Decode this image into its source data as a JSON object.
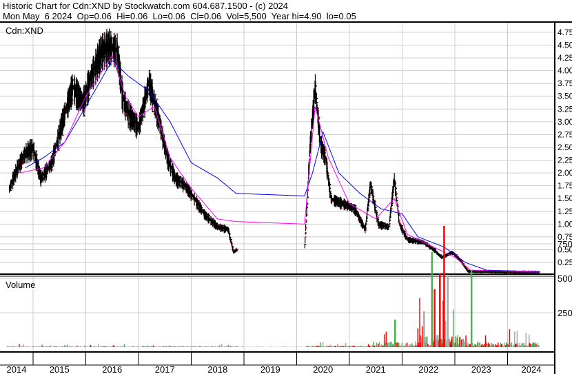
{
  "header": {
    "title": "Historic Chart for Cdn:XND by Stockwatch.com 604.687.1500 - (c) 2024",
    "quote": "Mon May  6 2024  Op=0.06  Hi=0.06  Lo=0.06  Cl=0.06  Vol=5,500  Year hi=4.90  lo=0.05"
  },
  "chart_data": [
    {
      "type": "line",
      "title": "Cdn:XND",
      "ylim": [
        0,
        4.9
      ],
      "yticks": [
        "4.75",
        "4.50",
        "4.25",
        "4.00",
        "3.75",
        "3.50",
        "3.25",
        "3.00",
        "2.75",
        "2.50",
        "2.25",
        "2.00",
        "1.75",
        "1.50",
        "1.25",
        "1.00",
        "0.75",
        "0.50",
        "0.25"
      ],
      "price_keypoints": [
        [
          2014.55,
          1.7
        ],
        [
          2014.7,
          2.1
        ],
        [
          2014.85,
          2.4
        ],
        [
          2015.0,
          2.5
        ],
        [
          2015.15,
          1.9
        ],
        [
          2015.35,
          2.2
        ],
        [
          2015.55,
          3.0
        ],
        [
          2015.75,
          3.7
        ],
        [
          2015.95,
          3.4
        ],
        [
          2016.1,
          3.9
        ],
        [
          2016.3,
          4.4
        ],
        [
          2016.45,
          4.5
        ],
        [
          2016.6,
          4.4
        ],
        [
          2016.7,
          3.5
        ],
        [
          2016.8,
          3.2
        ],
        [
          2017.0,
          2.9
        ],
        [
          2017.2,
          3.8
        ],
        [
          2017.4,
          3.0
        ],
        [
          2017.55,
          2.3
        ],
        [
          2017.7,
          1.9
        ],
        [
          2017.85,
          1.8
        ],
        [
          2018.0,
          1.6
        ],
        [
          2018.25,
          1.2
        ],
        [
          2018.5,
          0.95
        ],
        [
          2018.7,
          0.9
        ],
        [
          2018.8,
          0.45
        ],
        [
          2018.85,
          0.5
        ],
        [
          2020.15,
          0.5
        ],
        [
          2020.25,
          2.5
        ],
        [
          2020.35,
          3.7
        ],
        [
          2020.45,
          2.6
        ],
        [
          2020.55,
          2.3
        ],
        [
          2020.65,
          1.5
        ],
        [
          2020.9,
          1.4
        ],
        [
          2021.1,
          1.3
        ],
        [
          2021.3,
          0.9
        ],
        [
          2021.4,
          1.8
        ],
        [
          2021.55,
          1.0
        ],
        [
          2021.75,
          0.95
        ],
        [
          2021.85,
          1.9
        ],
        [
          2021.95,
          1.0
        ],
        [
          2022.1,
          0.7
        ],
        [
          2022.4,
          0.65
        ],
        [
          2022.6,
          0.5
        ],
        [
          2022.75,
          0.35
        ],
        [
          2022.95,
          0.45
        ],
        [
          2023.1,
          0.3
        ],
        [
          2023.25,
          0.08
        ],
        [
          2024.6,
          0.06
        ]
      ],
      "ma_short_keypoints": [
        [
          2014.75,
          2.0
        ],
        [
          2015.2,
          2.1
        ],
        [
          2015.6,
          2.6
        ],
        [
          2016.0,
          3.5
        ],
        [
          2016.5,
          4.3
        ],
        [
          2016.75,
          3.5
        ],
        [
          2017.0,
          3.1
        ],
        [
          2017.3,
          3.3
        ],
        [
          2017.6,
          2.3
        ],
        [
          2018.0,
          1.7
        ],
        [
          2018.5,
          1.1
        ],
        [
          2018.85,
          1.05
        ],
        [
          2020.15,
          1.0
        ],
        [
          2020.35,
          3.3
        ],
        [
          2020.6,
          2.3
        ],
        [
          2021.0,
          1.4
        ],
        [
          2021.5,
          1.1
        ],
        [
          2021.85,
          1.5
        ],
        [
          2022.1,
          0.8
        ],
        [
          2022.6,
          0.55
        ],
        [
          2023.0,
          0.35
        ],
        [
          2023.3,
          0.1
        ],
        [
          2024.6,
          0.06
        ]
      ],
      "ma_long_keypoints": [
        [
          2014.85,
          2.1
        ],
        [
          2015.2,
          2.3
        ],
        [
          2015.6,
          2.6
        ],
        [
          2016.0,
          3.3
        ],
        [
          2016.5,
          4.2
        ],
        [
          2016.8,
          3.9
        ],
        [
          2017.2,
          3.6
        ],
        [
          2017.6,
          3.0
        ],
        [
          2018.0,
          2.2
        ],
        [
          2018.5,
          1.9
        ],
        [
          2018.85,
          1.6
        ],
        [
          2020.15,
          1.55
        ],
        [
          2020.3,
          2.0
        ],
        [
          2020.5,
          2.8
        ],
        [
          2020.8,
          2.0
        ],
        [
          2021.2,
          1.6
        ],
        [
          2021.6,
          1.3
        ],
        [
          2022.0,
          1.2
        ],
        [
          2022.3,
          0.75
        ],
        [
          2022.8,
          0.55
        ],
        [
          2023.2,
          0.25
        ],
        [
          2023.6,
          0.1
        ],
        [
          2024.6,
          0.07
        ]
      ]
    },
    {
      "type": "bar",
      "title": "Volume",
      "ylim": [
        0,
        900000
      ],
      "yticks": [
        "750 k",
        "500 k",
        "250 k"
      ],
      "spikes": [
        [
          2022.55,
          690000,
          "green"
        ],
        [
          2022.7,
          530000,
          "red"
        ],
        [
          2022.78,
          880000,
          "red"
        ],
        [
          2022.85,
          520000,
          "gray"
        ],
        [
          2023.3,
          560000,
          "green"
        ],
        [
          2021.85,
          200000,
          "green"
        ],
        [
          2022.4,
          260000,
          "gray"
        ],
        [
          2022.6,
          420000,
          "red"
        ]
      ]
    }
  ],
  "xaxis": {
    "years": [
      "2014",
      "2015",
      "2016",
      "2017",
      "2018",
      "2019",
      "2020",
      "2021",
      "2022",
      "2023",
      "2024"
    ]
  }
}
